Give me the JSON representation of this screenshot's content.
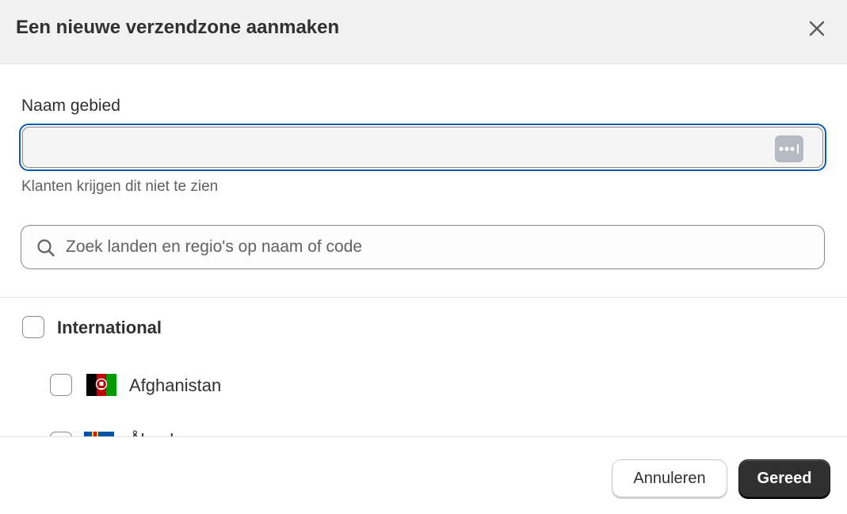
{
  "modal": {
    "title": "Een nieuwe verzendzone aanmaken",
    "close_icon": "close-icon"
  },
  "zone_name": {
    "label": "Naam gebied",
    "value": "",
    "help": "Klanten krijgen dit niet te zien",
    "autofill_icon": "password-manager-icon"
  },
  "search": {
    "placeholder": "Zoek landen en regio's op naam of code",
    "icon": "search-icon"
  },
  "list": {
    "group": {
      "label": "International",
      "checked": false
    },
    "items": [
      {
        "label": "Afghanistan",
        "flag": "afghanistan-flag",
        "checked": false
      },
      {
        "label": "Åland",
        "flag": "aland-flag",
        "checked": false
      }
    ]
  },
  "footer": {
    "cancel_label": "Annuleren",
    "done_label": "Gereed"
  }
}
